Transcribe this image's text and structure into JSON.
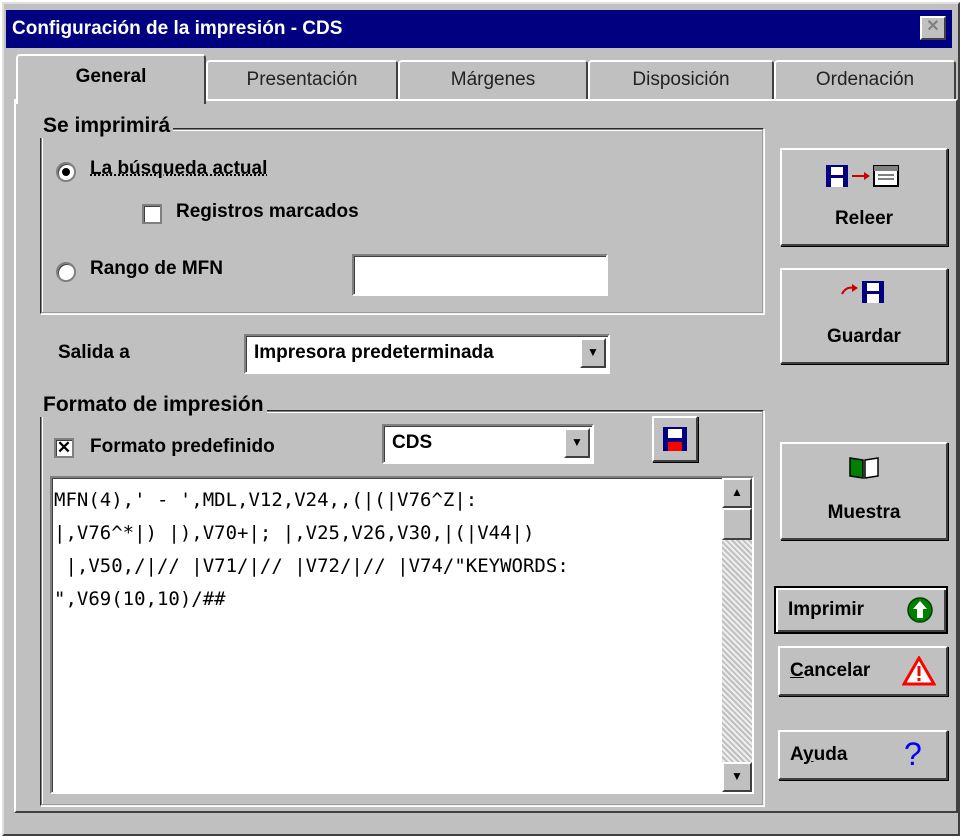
{
  "window": {
    "title": "Configuración de la impresión - CDS",
    "close_glyph": "✕"
  },
  "tabs": [
    {
      "label": "General",
      "active": true
    },
    {
      "label": "Presentación",
      "active": false
    },
    {
      "label": "Márgenes",
      "active": false
    },
    {
      "label": "Disposición",
      "active": false
    },
    {
      "label": "Ordenación",
      "active": false
    }
  ],
  "print_scope": {
    "group_label": "Se imprimirá",
    "current_search_label": "La búsqueda actual",
    "current_search_selected": true,
    "marked_records_label": "Registros marcados",
    "marked_records_checked": false,
    "mfn_range_label": "Rango de MFN",
    "mfn_range_selected": false,
    "mfn_range_value": ""
  },
  "output": {
    "label": "Salida a",
    "selected": "Impresora predeterminada"
  },
  "print_format": {
    "group_label": "Formato de impresión",
    "predefined_label": "Formato predefinido",
    "predefined_checked": true,
    "check_mark": "✕",
    "format_selected": "CDS",
    "format_text": "MFN(4),' - ',MDL,V12,V24,,(|(|V76^Z|:\n|,V76^*|) |),V70+|; |,V25,V26,V30,|(|V44|)\n |,V50,/|// |V71/|// |V72/|// |V74/\"KEYWORDS:\n\",V69(10,10)/##"
  },
  "buttons": {
    "reread": "Releer",
    "save": "Guardar",
    "sample": "Muestra",
    "print": "Imprimir",
    "cancel_accel": "C",
    "cancel_rest": "ancelar",
    "help_prefix": "A",
    "help_accel": "y",
    "help_rest": "uda",
    "help_glyph": "?"
  },
  "icons": {
    "reread": "save-to-window-icon",
    "save": "arrow-to-disk-icon",
    "format_save": "floppy-disk-icon",
    "sample": "open-book-icon",
    "print": "green-up-arrow-icon",
    "cancel": "warning-triangle-icon",
    "help": "question-mark-icon",
    "scroll_up": "▲",
    "scroll_down": "▼",
    "combo_arrow": "▼"
  },
  "colors": {
    "titlebar": "#000080",
    "face": "#c0c0c0",
    "disk_blue": "#000080",
    "book_green": "#008000",
    "print_green": "#008000",
    "warning_red": "#ff0000",
    "help_blue": "#0000ff"
  }
}
